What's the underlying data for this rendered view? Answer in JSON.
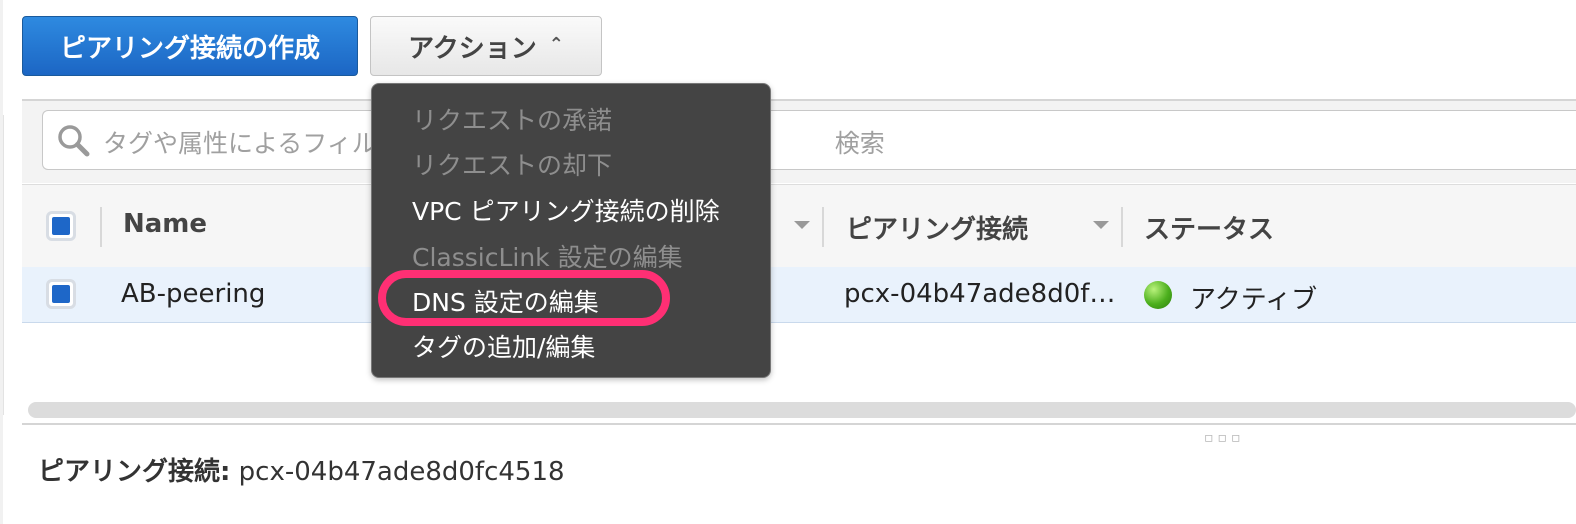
{
  "toolbar": {
    "create_label": "ピアリング接続の作成",
    "actions_label": "アクション",
    "actions_chevron": "⌃"
  },
  "search": {
    "placeholder_visible_start": "タグや属性によるフィル",
    "placeholder_visible_end": "検索"
  },
  "table": {
    "headers": {
      "name": "Name",
      "peering": "ピアリング接続",
      "status": "ステータス"
    },
    "rows": [
      {
        "name": "AB-peering",
        "peering_connection": "pcx-04b47ade8d0f…",
        "status": "アクティブ",
        "status_color": "#4caf1d",
        "checked": true
      }
    ]
  },
  "actions_menu": {
    "items": [
      {
        "label": "リクエストの承諾",
        "enabled": false
      },
      {
        "label": "リクエストの却下",
        "enabled": false
      },
      {
        "label": "VPC ピアリング接続の削除",
        "enabled": true
      },
      {
        "label": "ClassicLink 設定の編集",
        "enabled": false
      },
      {
        "label": "DNS 設定の編集",
        "enabled": true,
        "highlighted": true
      },
      {
        "label": "タグの追加/編集",
        "enabled": true
      }
    ],
    "highlight_color": "#ff2f74"
  },
  "details": {
    "label": "ピアリング接続:",
    "value": "pcx-04b47ade8d0fc4518"
  },
  "colors": {
    "primary_button": "#1c66c4",
    "menu_background": "#444444",
    "selected_row": "#e9f2fc"
  }
}
